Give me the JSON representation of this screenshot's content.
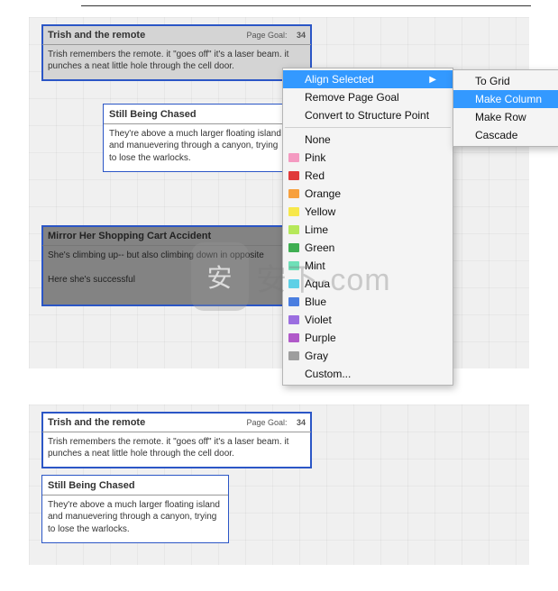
{
  "cards_top": [
    {
      "title": "Trish and the remote",
      "meta_label": "Page Goal:",
      "meta_num": "34",
      "body": "Trish remembers the remote. it \"goes off\" it's a laser beam. it punches a neat little hole through the cell door."
    },
    {
      "title": "Still Being Chased",
      "body": "They're above a much larger floating island and manuevering through a canyon, trying to lose the warlocks."
    },
    {
      "title": "Mirror Her Shopping Cart Accident",
      "body": "She's climbing up-- but also climbing down in opposite\n\nHere she's successful"
    }
  ],
  "cards_bottom": [
    {
      "title": "Trish and the remote",
      "meta_label": "Page Goal:",
      "meta_num": "34",
      "body": "Trish remembers the remote. it \"goes off\" it's a laser beam. it punches a neat little hole through the cell door."
    },
    {
      "title": "Still Being Chased",
      "body": "They're above a much larger floating island and manuevering through a canyon, trying to lose the warlocks."
    }
  ],
  "menu": {
    "align_selected": "Align Selected",
    "remove_page_goal": "Remove Page Goal",
    "convert_structure": "Convert to Structure Point",
    "none": "None",
    "custom": "Custom...",
    "colors": [
      {
        "name": "Pink",
        "hex": "#f49ac1"
      },
      {
        "name": "Red",
        "hex": "#e03a3a"
      },
      {
        "name": "Orange",
        "hex": "#f7a03d"
      },
      {
        "name": "Yellow",
        "hex": "#f7e84b"
      },
      {
        "name": "Lime",
        "hex": "#b6e85a"
      },
      {
        "name": "Green",
        "hex": "#3fae52"
      },
      {
        "name": "Mint",
        "hex": "#6fe0b8"
      },
      {
        "name": "Aqua",
        "hex": "#5fd0e6"
      },
      {
        "name": "Blue",
        "hex": "#4a7ee0"
      },
      {
        "name": "Violet",
        "hex": "#9b6ee0"
      },
      {
        "name": "Purple",
        "hex": "#b059c9"
      },
      {
        "name": "Gray",
        "hex": "#9e9e9e"
      }
    ]
  },
  "submenu": {
    "to_grid": "To Grid",
    "make_column": "Make Column",
    "make_row": "Make Row",
    "cascade": "Cascade"
  },
  "watermark": {
    "text": "安下·com",
    "shield": "安"
  }
}
